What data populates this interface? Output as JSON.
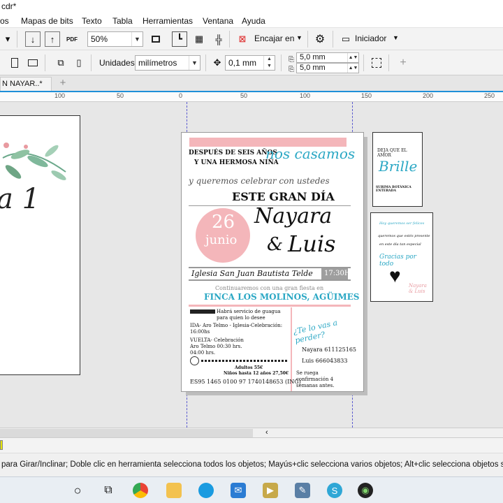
{
  "window": {
    "title": "cdr*"
  },
  "menu": [
    "os",
    "Mapas de bits",
    "Texto",
    "Tabla",
    "Herramientas",
    "Ventana",
    "Ayuda"
  ],
  "toolbar1": {
    "zoom": "50%",
    "snap_label": "Encajar en",
    "launcher_label": "Iniciador"
  },
  "toolbar2": {
    "units_label": "Unidades:",
    "units_value": "milímetros",
    "nudge": "0,1 mm",
    "dup_x": "5,0 mm",
    "dup_y": "5,0 mm"
  },
  "tab": {
    "label": "N NAYAR..*"
  },
  "ruler": {
    "ticks": [
      "100",
      "50",
      "0",
      "50",
      "100",
      "150",
      "200",
      "250"
    ]
  },
  "left_page": {
    "text": "a 1"
  },
  "invitation": {
    "line1": "DESPUÉS DE SEIS AÑOS",
    "line2": "Y UNA HERMOSA NIÑA",
    "casamos": "nos casamos",
    "queremos": "y queremos celebrar con ustedes",
    "gran_dia": "ESTE GRAN DÍA",
    "day": "26",
    "month": "junio",
    "name1": "Nayara",
    "amp": "&",
    "name2": "Luis",
    "church": "Iglesia San Juan Bautista Telde",
    "time": "17:30H",
    "continuamos": "Continuaremos con una gran fiesta en",
    "finca": "FINCA LOS MOLINOS, AGÜIMES",
    "guagua": "Habrá servicio de guagua para quien lo desee",
    "ida": "IDA- Aro Telmo - Iglesia-Celebración: 16:00hs",
    "vuelta": "VUELTA- Celebración Aro Telmo 00:30 hrs. 04:00 hrs.",
    "adultos": "Adultos 55€",
    "ninos": "Niños hasta 12 años 27,50€",
    "iban": "ES95 1465 0100 97 1740148653 (ING)",
    "confirm": "¿Te lo vas a perder?",
    "phone1": "Nayara 611125165",
    "phone2": "Luis 666043833",
    "ruega": "Se ruega confirmación 4 semanas antes."
  },
  "card1": {
    "top": "DEJA QUE EL AMOR",
    "brille": "Brille",
    "bottom": "SURIMA BOTÁNICA ENTERADA"
  },
  "card2": {
    "l1": "Hoy queremos ser felices",
    "l2": "queremos que estés presente",
    "l3": "en este día tan especial",
    "l4": "Gracias por todo",
    "names": "Nayara & Luis"
  },
  "statusbar": {
    "hint": "para Girar/Inclinar; Doble clic en herramienta selecciona todos los objetos; Mayús+clic selecciona varios objetos; Alt+clic selecciona objetos subya"
  },
  "colors": {
    "pink": "#f4b6ba",
    "teal": "#2aa7c4",
    "gray": "#9e9e9e",
    "accent": "#1e8fd8"
  }
}
